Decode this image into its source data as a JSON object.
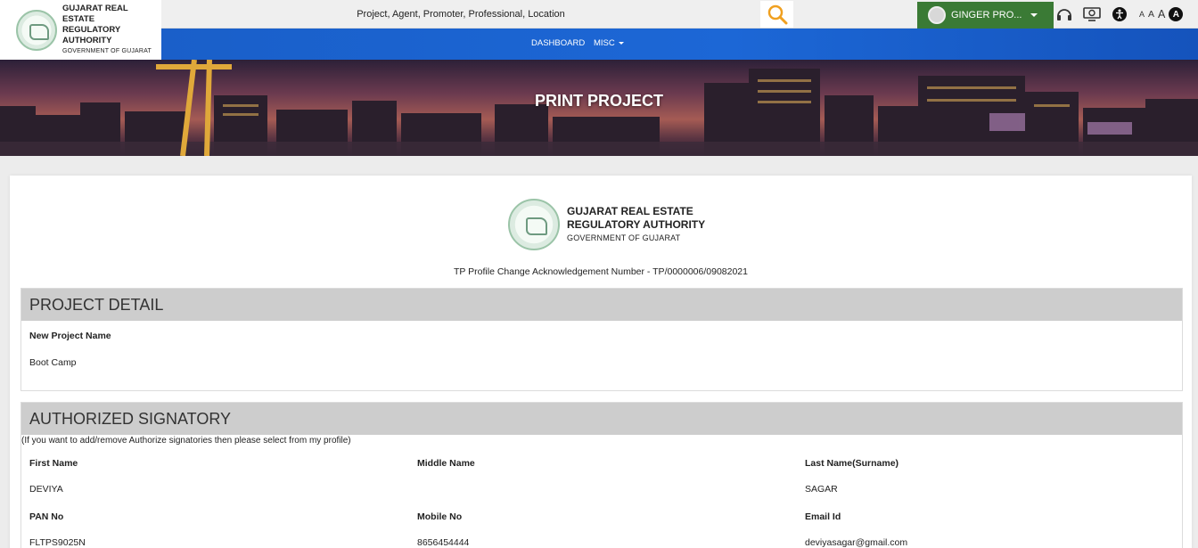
{
  "header": {
    "logo": {
      "line1": "GUJARAT REAL ESTATE",
      "line2": "REGULATORY AUTHORITY",
      "line3": "GOVERNMENT OF GUJARAT"
    },
    "search": {
      "placeholder": "Project, Agent, Promoter, Professional, Location"
    },
    "user": {
      "name": "GINGER PRO..."
    },
    "tools": {
      "icons": [
        "screen-reader-icon",
        "display-settings-icon",
        "accessibility-icon"
      ]
    },
    "font_sizes": [
      "A",
      "A",
      "A",
      "A"
    ]
  },
  "nav": {
    "dashboard": "DASHBOARD",
    "misc": "MISC"
  },
  "banner": {
    "title": "PRINT PROJECT"
  },
  "document": {
    "logo": {
      "line1": "GUJARAT REAL ESTATE",
      "line2": "REGULATORY AUTHORITY",
      "line3": "GOVERNMENT OF GUJARAT"
    },
    "acknowledgement": "TP Profile Change Acknowledgement Number - TP/0000006/09082021",
    "project_detail": {
      "heading": "PROJECT DETAIL",
      "label": "New Project Name",
      "value": "Boot Camp"
    },
    "authorized_signatory": {
      "heading": "AUTHORIZED SIGNATORY",
      "note": "(If you want to add/remove Authorize signatories then please select from my profile)",
      "fields": [
        {
          "label": "First Name",
          "value": "DEVIYA"
        },
        {
          "label": "Middle Name",
          "value": ""
        },
        {
          "label": "Last Name(Surname)",
          "value": "SAGAR"
        },
        {
          "label": "PAN No",
          "value": "FLTPS9025N"
        },
        {
          "label": "Mobile No",
          "value": "8656454444"
        },
        {
          "label": "Email Id",
          "value": "deviyasagar@gmail.com"
        }
      ]
    }
  },
  "colors": {
    "nav_blue": "#1c67d6",
    "user_green": "#3a7a35",
    "section_grey": "#cdcdcd"
  }
}
